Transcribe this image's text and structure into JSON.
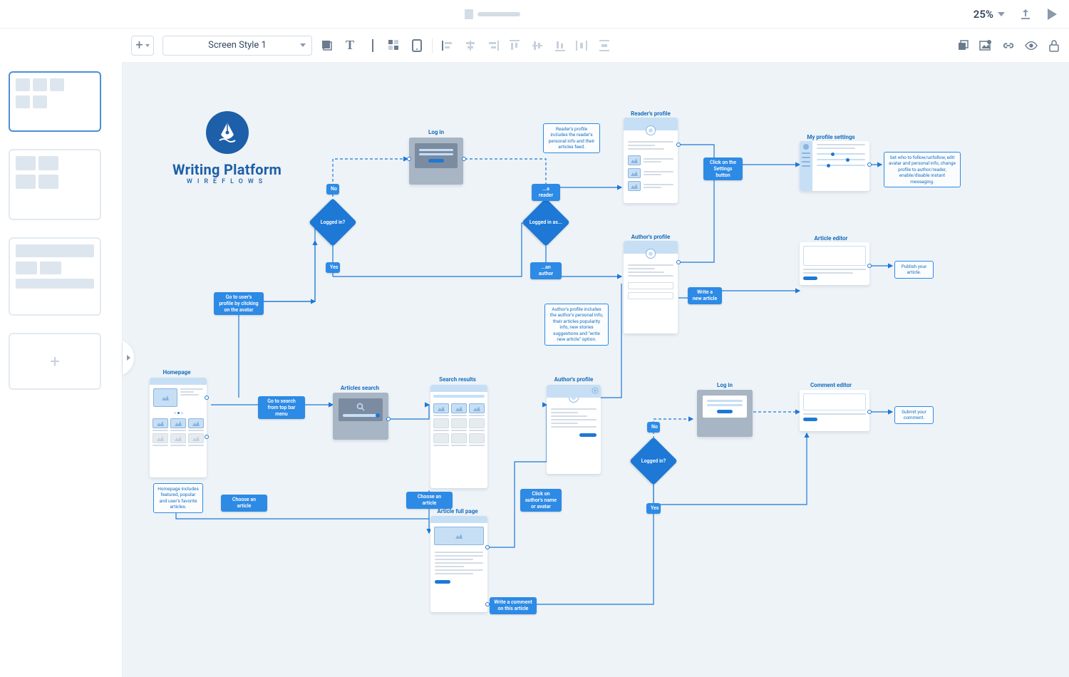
{
  "titleBar": {
    "zoom": "25%"
  },
  "toolbar": {
    "styleSelect": "Screen Style 1"
  },
  "logo": {
    "name": "Writing Platform",
    "sub": "WIREFLOWS"
  },
  "labels": {
    "login": "Log in",
    "readersProfile": "Reader's profile",
    "myProfileSettings": "My profile settings",
    "authorsProfile": "Author's profile",
    "articleEditor": "Article editor",
    "homepage": "Homepage",
    "articlesSearch": "Articles search",
    "searchResults": "Search results",
    "authorsProfile2": "Author's profile",
    "login2": "Log in",
    "commentEditor": "Comment editor",
    "articleFullPage": "Article full page"
  },
  "decisions": {
    "loggedIn": "Logged in?",
    "loggedInAs": "Logged in as...",
    "loggedIn2": "Logged in?"
  },
  "actions": {
    "no": "No",
    "yes": "Yes",
    "reader": "...a reader",
    "author": "...an author",
    "settingsBtn": "Click on the Settings button",
    "writeArticle": "Write a new article",
    "gotoProfile": "Go to user's profile by clicking on the avatar",
    "gotoSearch": "Go to search from top bar menu",
    "chooseArticle": "Choose an article",
    "chooseArticle2": "Choose an article",
    "clickAuthor": "Click on author's name or avatar",
    "writeComment": "Write a comment on this article",
    "no2": "No",
    "yes2": "Yes"
  },
  "notes": {
    "readersProfile": "Reader's profile includes the reader's personal info and their articles feed.",
    "authorsProfile": "Author's profile includes the author's personal info, their articles popularity info, new stories suggestions and \"write new article\" option.",
    "homepage": "Homepage includes featured, popular and user's favorite articles.",
    "profileSettings": "Set who to follow/unfollow, edit avatar and personal info, change profile to author/reader, enable/disable instant messaging.",
    "publish": "Publish your article.",
    "submitComment": "Submit your comment."
  }
}
